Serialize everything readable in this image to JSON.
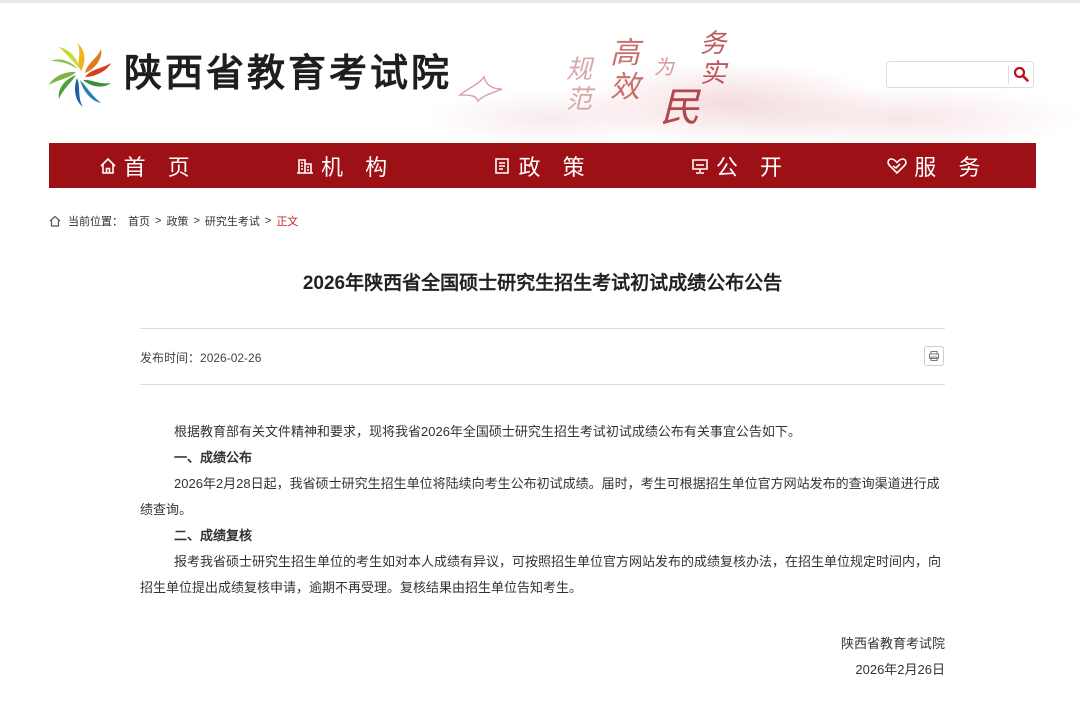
{
  "site": {
    "name": "陕西省教育考试院",
    "slogan": [
      "规范",
      "高效",
      "为",
      "民",
      "务实"
    ]
  },
  "search": {
    "placeholder": "",
    "value": ""
  },
  "nav": {
    "items": [
      {
        "label": "首 页",
        "icon": "home-icon"
      },
      {
        "label": "机 构",
        "icon": "building-icon"
      },
      {
        "label": "政 策",
        "icon": "policy-icon"
      },
      {
        "label": "公 开",
        "icon": "monitor-icon"
      },
      {
        "label": "服 务",
        "icon": "heart-hand-icon"
      }
    ]
  },
  "breadcrumb": {
    "prefix": "当前位置：",
    "items": [
      "首页",
      "政策",
      "研究生考试"
    ],
    "separator": ">",
    "current": "正文"
  },
  "article": {
    "title": "2026年陕西省全国硕士研究生招生考试初试成绩公布公告",
    "publish_label": "发布时间：",
    "publish_date": "2026-02-26",
    "intro": "根据教育部有关文件精神和要求，现将我省2026年全国硕士研究生招生考试初试成绩公布有关事宜公告如下。",
    "section1_heading": "一、成绩公布",
    "section1_text": "2026年2月28日起，我省硕士研究生招生单位将陆续向考生公布初试成绩。届时，考生可根据招生单位官方网站发布的查询渠道进行成绩查询。",
    "section2_heading": "二、成绩复核",
    "section2_text": "报考我省硕士研究生招生单位的考生如对本人成绩有异议，可按照招生单位官方网站发布的成绩复核办法，在招生单位规定时间内，向招生单位提出成绩复核申请，逾期不再受理。复核结果由招生单位告知考生。",
    "signature_org": "陕西省教育考试院",
    "signature_date": "2026年2月26日"
  },
  "colors": {
    "nav_bg": "#9c1016",
    "breadcrumb_current": "#c0272d",
    "search_icon": "#b5121b"
  }
}
